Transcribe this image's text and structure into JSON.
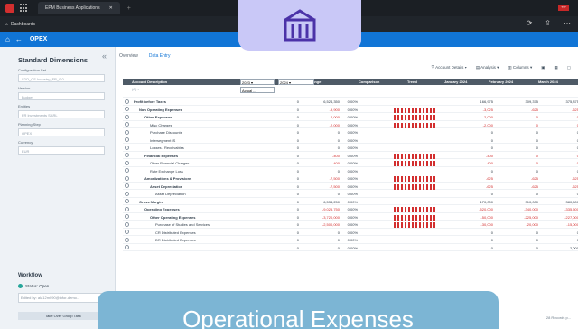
{
  "browser": {
    "tab_title": "EPM Business Applications",
    "badge": "???"
  },
  "appbar": {
    "breadcrumb": "Dashboards"
  },
  "header": {
    "title": "OPEX"
  },
  "sidebar": {
    "title": "Standard Dimensions",
    "fields": [
      {
        "label": "Configuration Set",
        "value": "S2O_CS-Industry_FR_0.0"
      },
      {
        "label": "Version",
        "value": "Budget"
      },
      {
        "label": "Entities",
        "value": "FR Investments SARL"
      },
      {
        "label": "Planning Step",
        "value": "OPEX"
      },
      {
        "label": "Currency",
        "value": "EUR"
      }
    ],
    "workflow": {
      "title": "Workflow",
      "status": "Status: Open",
      "edited": "Edited by: ala12m090@infor-demo...",
      "takeover": "Take Over Group Task"
    }
  },
  "tabs": [
    "Overview",
    "Data Entry"
  ],
  "toolbar": {
    "account_details": "Account Details",
    "analysis": "Analysis",
    "columns": "Columns"
  },
  "grid": {
    "headers": {
      "account": "Account Description",
      "c2023": "2023",
      "c2024": "2024",
      "pct": "% Change",
      "comparison": "Comparison",
      "trend": "Trend",
      "jan": "January 2024",
      "feb": "February 2024",
      "mar": "March 2024"
    },
    "filter": "(A) •",
    "actual": "Actual ...",
    "rows": [
      {
        "name": "Profit before Taxes",
        "v2023": "0",
        "v2024": "6,524,350",
        "pct": "0.00%",
        "jan": "166,975",
        "feb": "309,375",
        "mar": "375,875",
        "neg": false,
        "bold": true,
        "indent": 0
      },
      {
        "name": "Non Operating Expenses",
        "v2023": "0",
        "v2024": "-9,900",
        "pct": "0.00%",
        "jan": "-3,025",
        "feb": "-625",
        "mar": "-625",
        "neg": true,
        "bold": true,
        "indent": 1
      },
      {
        "name": "Other Expenses",
        "v2023": "0",
        "v2024": "-2,000",
        "pct": "0.00%",
        "jan": "-2,000",
        "feb": "0",
        "mar": "0",
        "neg": true,
        "bold": true,
        "indent": 2
      },
      {
        "name": "Misc Charges",
        "v2023": "0",
        "v2024": "-2,000",
        "pct": "0.00%",
        "jan": "-2,000",
        "feb": "0",
        "mar": "0",
        "neg": true,
        "bold": false,
        "indent": 3
      },
      {
        "name": "Purchase Discounts",
        "v2023": "0",
        "v2024": "0",
        "pct": "0.00%",
        "jan": "0",
        "feb": "0",
        "mar": "0",
        "neg": false,
        "bold": false,
        "indent": 3
      },
      {
        "name": "Intersegment IS",
        "v2023": "0",
        "v2024": "0",
        "pct": "0.00%",
        "jan": "0",
        "feb": "0",
        "mar": "0",
        "neg": false,
        "bold": false,
        "indent": 3
      },
      {
        "name": "Losses / Receivables",
        "v2023": "0",
        "v2024": "0",
        "pct": "0.00%",
        "jan": "0",
        "feb": "0",
        "mar": "0",
        "neg": false,
        "bold": false,
        "indent": 3
      },
      {
        "name": "Financial Expenses",
        "v2023": "0",
        "v2024": "-400",
        "pct": "0.00%",
        "jan": "-400",
        "feb": "0",
        "mar": "0",
        "neg": true,
        "bold": true,
        "indent": 2
      },
      {
        "name": "Other Financial Charges",
        "v2023": "0",
        "v2024": "-400",
        "pct": "0.00%",
        "jan": "-400",
        "feb": "0",
        "mar": "0",
        "neg": true,
        "bold": false,
        "indent": 3
      },
      {
        "name": "Rate Exchange Loss",
        "v2023": "0",
        "v2024": "0",
        "pct": "0.00%",
        "jan": "0",
        "feb": "0",
        "mar": "0",
        "neg": false,
        "bold": false,
        "indent": 3
      },
      {
        "name": "Amortizations & Provisions",
        "v2023": "0",
        "v2024": "-7,500",
        "pct": "0.00%",
        "jan": "-625",
        "feb": "-625",
        "mar": "-625",
        "neg": true,
        "bold": true,
        "indent": 2
      },
      {
        "name": "Asset Depreciation",
        "v2023": "0",
        "v2024": "-7,500",
        "pct": "0.00%",
        "jan": "-625",
        "feb": "-625",
        "mar": "-625",
        "neg": true,
        "bold": true,
        "indent": 3
      },
      {
        "name": "Asset Depreciation",
        "v2023": "0",
        "v2024": "0",
        "pct": "0.00%",
        "jan": "0",
        "feb": "0",
        "mar": "0",
        "neg": false,
        "bold": false,
        "indent": 4
      },
      {
        "name": "Gross Margin",
        "v2023": "0",
        "v2024": "6,534,250",
        "pct": "0.00%",
        "jan": "170,000",
        "feb": "310,000",
        "mar": "380,500",
        "neg": false,
        "bold": true,
        "indent": 1
      },
      {
        "name": "Operating Expenses",
        "v2023": "0",
        "v2024": "-9,025,750",
        "pct": "0.00%",
        "jan": "-520,000",
        "feb": "-340,000",
        "mar": "-335,500",
        "neg": true,
        "bold": true,
        "indent": 2
      },
      {
        "name": "Other Operating Expenses",
        "v2023": "0",
        "v2024": "-3,720,000",
        "pct": "0.00%",
        "jan": "-50,000",
        "feb": "-225,000",
        "mar": "-227,000",
        "neg": true,
        "bold": true,
        "indent": 3
      },
      {
        "name": "Purchase of Studies and Services",
        "v2023": "0",
        "v2024": "-2,500,000",
        "pct": "0.00%",
        "jan": "-30,000",
        "feb": "-20,000",
        "mar": "-15,000",
        "neg": true,
        "bold": false,
        "indent": 4
      },
      {
        "name": "CR Distributed Expenses",
        "v2023": "0",
        "v2024": "0",
        "pct": "0.00%",
        "jan": "0",
        "feb": "0",
        "mar": "0",
        "neg": false,
        "bold": false,
        "indent": 4
      },
      {
        "name": "DR Distributed Expenses",
        "v2023": "0",
        "v2024": "0",
        "pct": "0.00%",
        "jan": "0",
        "feb": "0",
        "mar": "0",
        "neg": false,
        "bold": false,
        "indent": 4
      },
      {
        "name": "",
        "v2023": "0",
        "v2024": "0",
        "pct": "0.00%",
        "jan": "0",
        "feb": "0",
        "mar": "-2,000",
        "neg": false,
        "bold": false,
        "indent": 4
      }
    ]
  },
  "records": "28 Records p...",
  "overlay_text": "Operational Expenses"
}
